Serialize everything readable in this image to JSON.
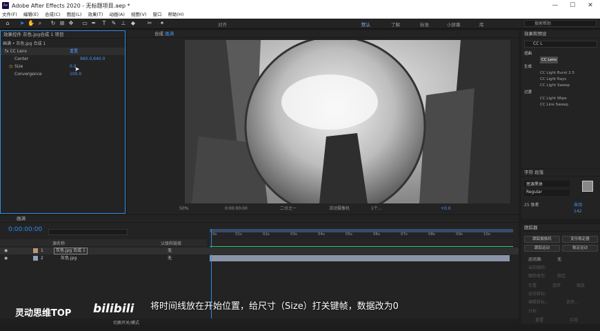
{
  "app": {
    "title": "Adobe After Effects 2020 - 无标题项目.aep *",
    "logo_text": "Ae"
  },
  "menu": [
    "文件(F)",
    "编辑(E)",
    "合成(C)",
    "图层(L)",
    "效果(T)",
    "动画(A)",
    "视图(V)",
    "窗口",
    "帮助(H)"
  ],
  "toolbar": {
    "snap_label": "对齐",
    "workspaces": [
      "默认",
      "了解",
      "标准",
      "小屏幕",
      "库"
    ],
    "search_placeholder": "搜索帮助"
  },
  "effect_controls": {
    "tab_label": "效果控件 灰色.jpg合成 1",
    "project_tab": "项目",
    "layer_path": "画满 • 灰色.jpg 合成 1",
    "effect_name": "CC Lens",
    "reset_label": "重置",
    "props": [
      {
        "name": "Center",
        "value": "960.0,640.0"
      },
      {
        "name": "Size",
        "value": "0.0"
      },
      {
        "name": "Convergence",
        "value": "100.0"
      }
    ]
  },
  "composition": {
    "tab_label": "合成",
    "comp_name": "画满",
    "zoom": "50%",
    "timecode": "0:00:00:00",
    "quality": "二分之一",
    "camera": "活动摄像机",
    "views": "1个...",
    "exposure": "+0.0"
  },
  "effects_presets": {
    "title": "效果和预设",
    "search_value": "CC L",
    "groups": [
      {
        "name": "扭曲",
        "items": [
          "CC Lens"
        ]
      },
      {
        "name": "生成",
        "items": [
          "CC Light Burst 2.5",
          "CC Light Rays",
          "CC Light Sweep"
        ]
      },
      {
        "name": "过渡",
        "items": [
          "CC Light Wipe",
          "CC Line Sweep"
        ]
      }
    ]
  },
  "character": {
    "tab1": "字符",
    "tab2": "段落",
    "font": "思源黑体",
    "style": "Regular",
    "size": "25 像素",
    "tracking": "自动",
    "leading": "142"
  },
  "tracker": {
    "title": "跟踪器",
    "buttons": [
      "跟踪摄像机",
      "变形稳定器",
      "跟踪运动",
      "稳定运动"
    ],
    "source_label": "运动源:",
    "source_value": "无",
    "current_track": "当前跟踪:",
    "track_type": "跟踪类型:",
    "track_type_value": "稳定",
    "position_label": "位置",
    "rotation_label": "旋转",
    "scale_label": "缩放",
    "target_label": "运动目标:",
    "edit_target": "编辑目标...",
    "options": "选项...",
    "analyze": "分析:",
    "reset": "重置",
    "apply": "应用"
  },
  "timeline": {
    "tab_label": "画满",
    "timecode": "0:00:00:00",
    "col_name": "源名称",
    "col_parent": "父级和链接",
    "footer_label": "切换开关/模式",
    "ticks": [
      "0s",
      "01s",
      "02s",
      "03s",
      "04s",
      "05s",
      "06s",
      "07s",
      "08s",
      "09s",
      "10s"
    ],
    "layers": [
      {
        "index": "1",
        "name": "灰色.jpg 合成 1",
        "parent": "无",
        "color": "#b59a76"
      },
      {
        "index": "2",
        "name": "灰色.jpg",
        "parent": "无",
        "color": "#8fa0b8"
      }
    ]
  },
  "overlay": {
    "subtitle": "将时间线放在开始位置，给尺寸（Size）打关键帧，数据改为0",
    "brand": "灵动思维TOP",
    "site_logo": "bilibili"
  }
}
